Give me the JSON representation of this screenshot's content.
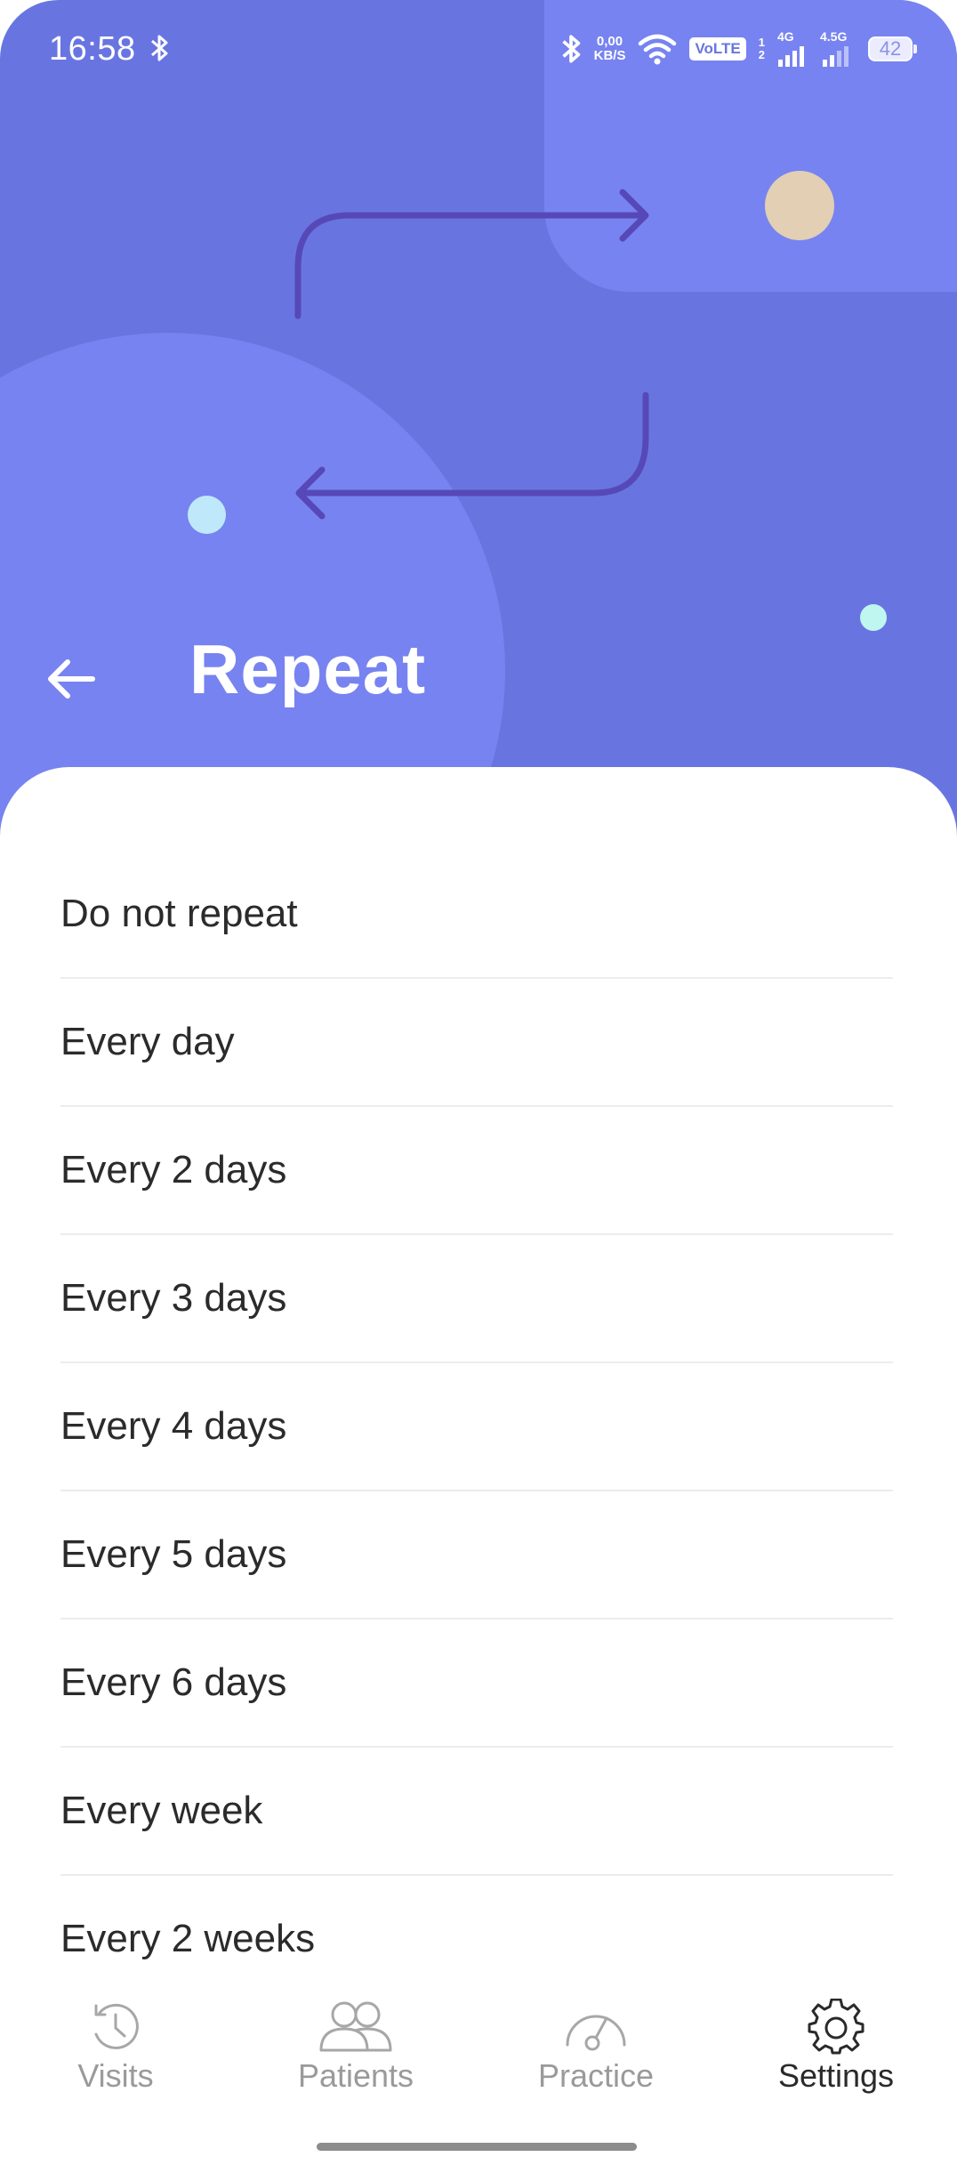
{
  "status_bar": {
    "time": "16:58",
    "net_speed_value": "0,00",
    "net_speed_unit": "KB/S",
    "volte": "VoLTE",
    "sim_top": "1",
    "sim_bottom": "2",
    "network_1": "4G",
    "network_2": "4.5G",
    "battery": "42"
  },
  "header": {
    "title": "Repeat",
    "back_icon": "arrow-left-icon",
    "illustration_icon": "repeat-arrows-icon",
    "colors": {
      "background": "#6875e1",
      "shape": "#7783f0",
      "arrow": "#5748b8",
      "dot_tan": "#e2cfb4",
      "dot_blue": "#bfe9fa",
      "dot_mint": "#bff7f0"
    }
  },
  "options": [
    "Do not repeat",
    "Every day",
    "Every 2 days",
    "Every 3 days",
    "Every 4 days",
    "Every 5 days",
    "Every 6 days",
    "Every week",
    "Every 2 weeks"
  ],
  "bottom_nav": {
    "items": [
      {
        "label": "Visits",
        "icon": "clock-history-icon",
        "active": false
      },
      {
        "label": "Patients",
        "icon": "people-icon",
        "active": false
      },
      {
        "label": "Practice",
        "icon": "gauge-icon",
        "active": false
      },
      {
        "label": "Settings",
        "icon": "gear-icon",
        "active": true
      }
    ]
  }
}
